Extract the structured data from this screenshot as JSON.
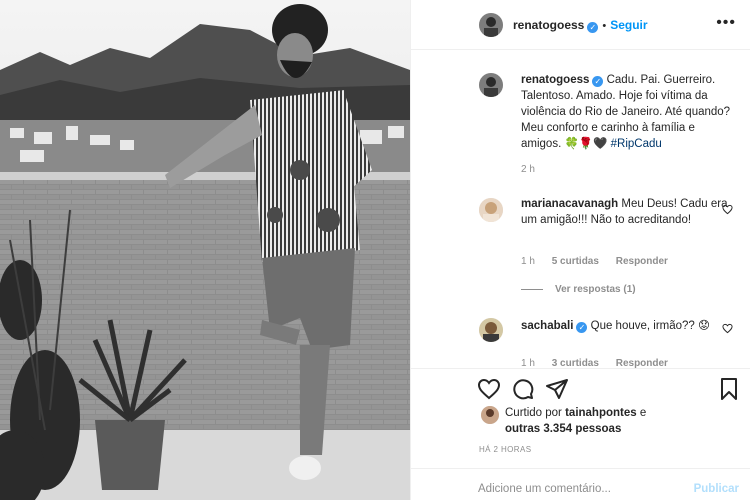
{
  "header": {
    "username": "renatogoess",
    "follow_label": "Seguir",
    "more_label": "•••"
  },
  "caption": {
    "username": "renatogoess",
    "text": "Cadu. Pai. Guerreiro. Talentoso. Amado. Hoje foi vítima da violência do Rio de Janeiro. Até quando? Meu conforto e carinho à família e amigos. 🍀🌹🖤",
    "hashtag": "#RipCadu",
    "time": "2 h"
  },
  "comments": [
    {
      "username": "marianacavanagh",
      "text": "Meu Deus! Cadu era um amigão!!! Não to acreditando!",
      "time": "1 h",
      "likes": "5 curtidas",
      "reply": "Responder",
      "view_replies": "Ver respostas (1)"
    },
    {
      "username": "sachabali",
      "text": "Que houve, irmão?? 😟",
      "time": "1 h",
      "likes": "3 curtidas",
      "reply": "Responder"
    }
  ],
  "likes": {
    "prefix": "Curtido por",
    "user": "tainahpontes",
    "middle": " e",
    "others": "outras 3.354 pessoas"
  },
  "timestamp": "HÁ 2 HORAS",
  "add_comment": {
    "placeholder": "Adicione um comentário...",
    "publish": "Publicar"
  },
  "colors": {
    "accent": "#0095f6",
    "verified": "#3897f0",
    "muted": "#8e8e8e"
  },
  "icons": [
    "heart-icon",
    "comment-icon",
    "share-icon",
    "bookmark-icon",
    "verified-badge-icon"
  ]
}
